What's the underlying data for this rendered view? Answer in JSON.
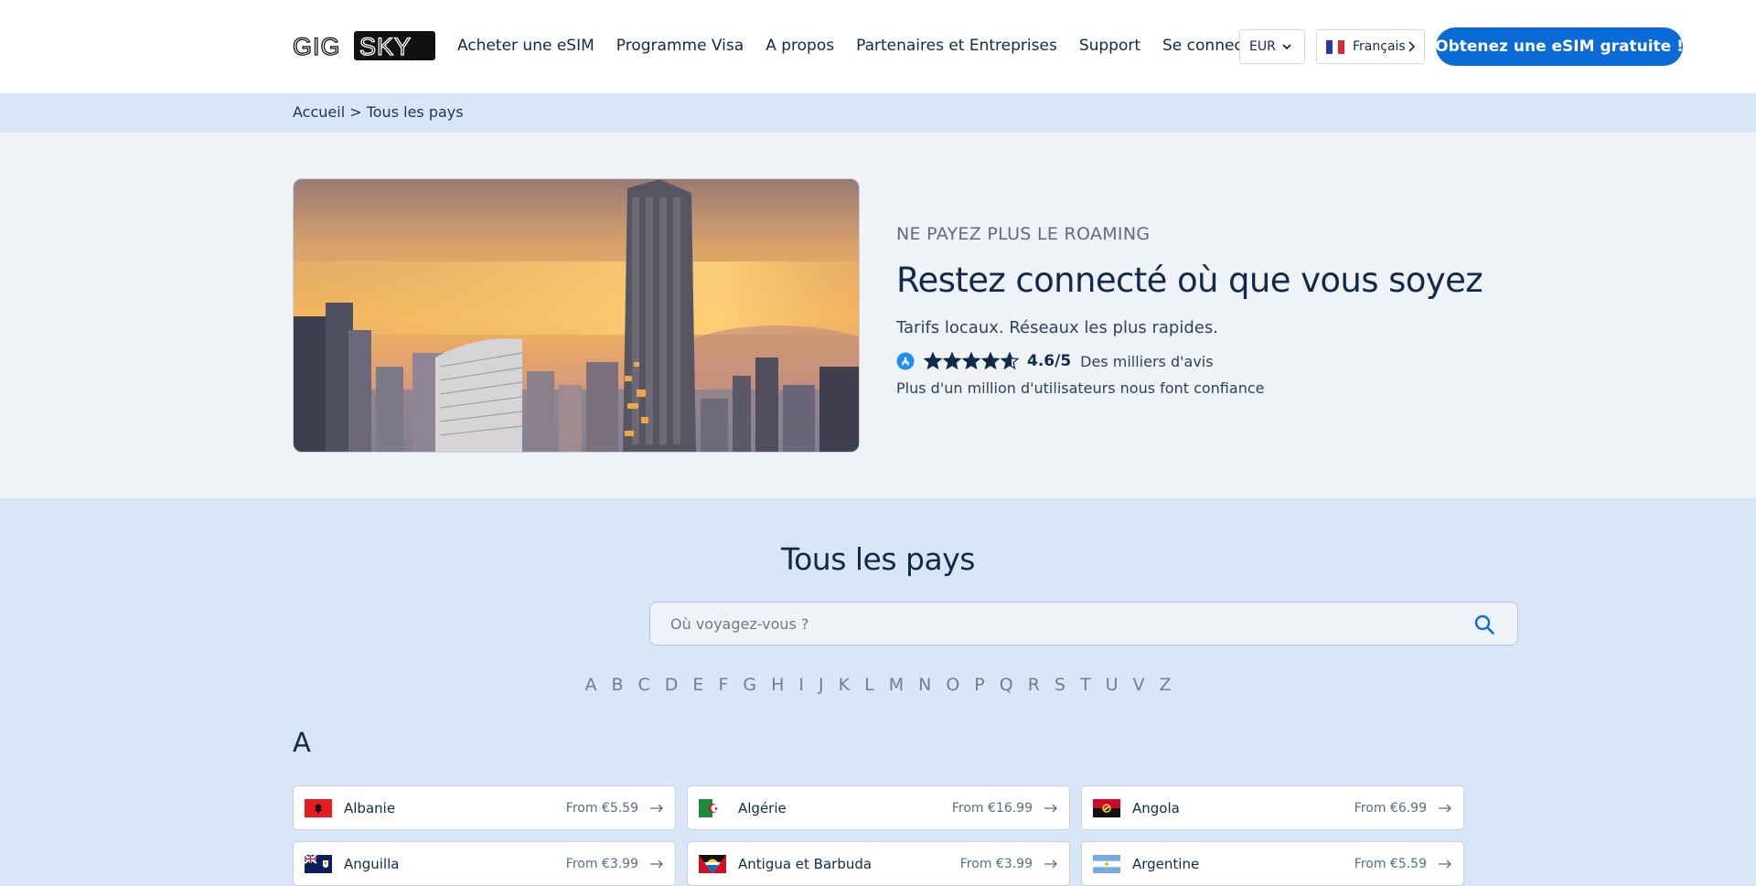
{
  "header": {
    "logo_text": "GigSky",
    "nav": [
      {
        "label": "Acheter une eSIM"
      },
      {
        "label": "Programme Visa"
      },
      {
        "label": "A propos"
      },
      {
        "label": "Partenaires et Entreprises"
      },
      {
        "label": "Support"
      },
      {
        "label": "Se connecter"
      }
    ],
    "currency": "EUR",
    "language": "Français",
    "cta_label": "Obtenez une eSIM gratuite !"
  },
  "breadcrumb": {
    "text": "Accueil > Tous les pays"
  },
  "hero": {
    "eyebrow": "NE PAYEZ PLUS LE ROAMING",
    "headline": "Restez connecté où que vous soyez",
    "subline": "Tarifs locaux. Réseaux les plus rapides.",
    "rating_value": 4.6,
    "rating_text": "4.6/5",
    "reviews_text": "Des milliers d'avis",
    "trust_text": "Plus d'un million d'utilisateurs nous font confiance"
  },
  "countries": {
    "title": "Tous les pays",
    "search_placeholder": "Où voyagez-vous ?",
    "alphabet": [
      "A",
      "B",
      "C",
      "D",
      "E",
      "F",
      "G",
      "H",
      "I",
      "J",
      "K",
      "L",
      "M",
      "N",
      "O",
      "P",
      "Q",
      "R",
      "S",
      "T",
      "U",
      "V",
      "Z"
    ],
    "group_letter": "A",
    "items": [
      {
        "name": "Albanie",
        "price": "From €5.59",
        "flag": "albania-flag-icon"
      },
      {
        "name": "Algérie",
        "price": "From €16.99",
        "flag": "algeria-flag-icon"
      },
      {
        "name": "Angola",
        "price": "From €6.99",
        "flag": "angola-flag-icon"
      },
      {
        "name": "Anguilla",
        "price": "From €3.99",
        "flag": "anguilla-flag-icon"
      },
      {
        "name": "Antigua et Barbuda",
        "price": "From €3.99",
        "flag": "antigua-flag-icon"
      },
      {
        "name": "Argentine",
        "price": "From €5.59",
        "flag": "argentina-flag-icon"
      }
    ]
  },
  "colors": {
    "accent": "#0a6bd6",
    "navy": "#0f2a4a",
    "light_blue": "#d8e6f8",
    "hero_bg": "#eff2f7"
  }
}
